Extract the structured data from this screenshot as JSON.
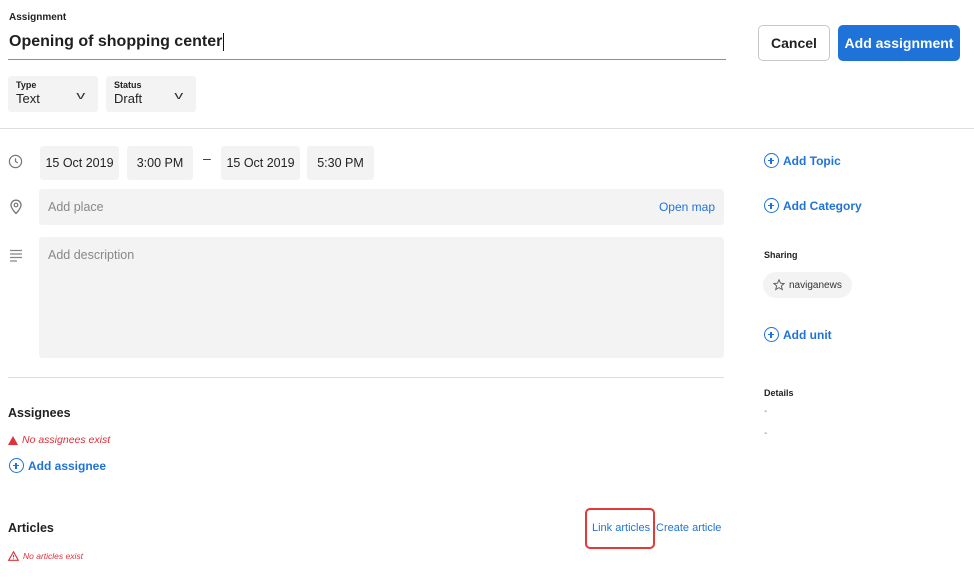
{
  "assignment": {
    "label": "Assignment",
    "title_value": "Opening of shopping center"
  },
  "actions": {
    "cancel_label": "Cancel",
    "add_label": "Add assignment"
  },
  "type_field": {
    "label": "Type",
    "value": "Text"
  },
  "status_field": {
    "label": "Status",
    "value": "Draft"
  },
  "schedule": {
    "start_date": "15 Oct 2019",
    "start_time": "3:00 PM",
    "separator": "–",
    "end_date": "15 Oct 2019",
    "end_time": "5:30 PM"
  },
  "place": {
    "placeholder": "Add place",
    "open_map_label": "Open map"
  },
  "description": {
    "placeholder": "Add description"
  },
  "assignees": {
    "title": "Assignees",
    "empty_text": "No assignees exist",
    "add_label": "Add assignee"
  },
  "articles": {
    "title": "Articles",
    "empty_text": "No articles exist",
    "link_label": "Link articles",
    "create_label": "Create article"
  },
  "sidebar": {
    "add_topic_label": "Add Topic",
    "add_category_label": "Add Category",
    "sharing_label": "Sharing",
    "sharing_tag": "naviganews",
    "add_unit_label": "Add unit",
    "details_label": "Details",
    "details_line_1": "-",
    "details_line_2": "-"
  },
  "colors": {
    "accent": "#1f73d8",
    "warning": "#e0303b",
    "highlight": "#e53935",
    "field_bg": "#f3f3f3"
  },
  "icons": {
    "time": "clock-icon",
    "place": "location-pin-icon",
    "description": "text-lines-icon",
    "add": "plus-circle-icon",
    "warning": "warning-triangle-icon",
    "sharing": "star-icon",
    "dropdown": "chevron-down-icon"
  }
}
